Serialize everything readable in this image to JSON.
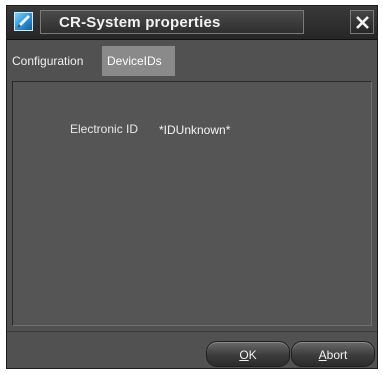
{
  "window": {
    "title": "CR-System properties",
    "app_icon": "app-icon",
    "close_icon": "close-icon"
  },
  "tabs": [
    {
      "label": "Configuration",
      "selected": false
    },
    {
      "label": "DeviceIDs",
      "selected": true
    }
  ],
  "device_ids": {
    "electronic_id_label": "Electronic ID",
    "electronic_id_value": "*IDUnknown*"
  },
  "buttons": {
    "ok": {
      "mnemonic": "O",
      "rest": "K"
    },
    "abort": {
      "mnemonic": "A",
      "rest": "bort"
    }
  },
  "colors": {
    "window_bg": "#515151",
    "titlebar_bg": "#262626",
    "selected_tab_bg": "#8a8a8a",
    "text": "#f0f0f0",
    "icon_accent": "#2a8fd6"
  }
}
